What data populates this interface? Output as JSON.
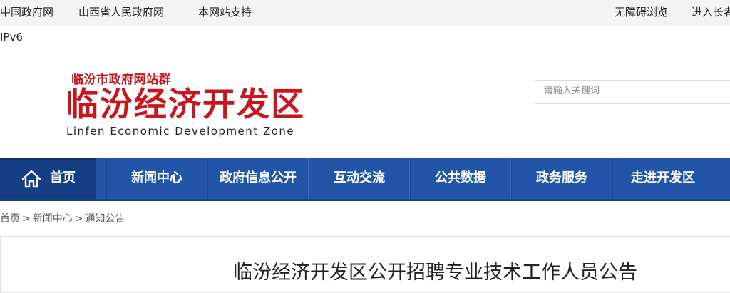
{
  "topbar": {
    "links": [
      "中国政府网",
      "山西省人民政府网",
      "本网站支持"
    ],
    "right_links": [
      "无障碍浏览",
      "进入长者"
    ]
  },
  "ipv6": "IPv6",
  "logo": {
    "subtitle": "临汾市政府网站群",
    "title": "临汾经济开发区",
    "english": "Linfen Economic Development Zone"
  },
  "search": {
    "placeholder": "请输入关键词",
    "value": ""
  },
  "nav": {
    "items": [
      "首页",
      "新闻中心",
      "政府信息公开",
      "互动交流",
      "公共数据",
      "政务服务",
      "走进开发区"
    ]
  },
  "breadcrumb": {
    "items": [
      "首页",
      "新闻中心",
      "通知公告"
    ],
    "separator": ">"
  },
  "article": {
    "title": "临汾经济开发区公开招聘专业技术工作人员公告"
  },
  "colors": {
    "brand_red": "#c8161d",
    "nav_blue": "#2255a7",
    "nav_active": "#163e85"
  }
}
